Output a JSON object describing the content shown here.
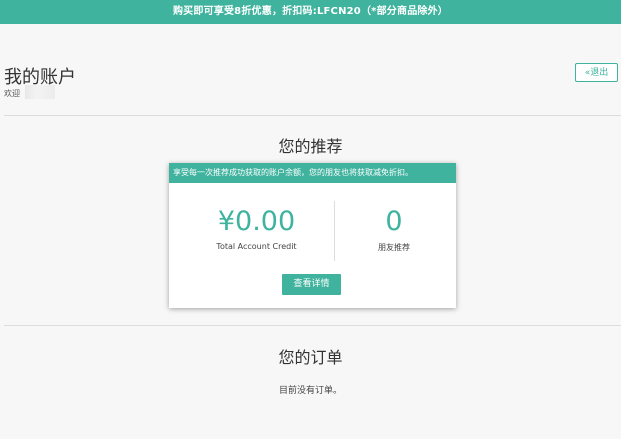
{
  "promo_banner": "购买即可享受8折优惠，折扣码:LFCN20（*部分商品除外）",
  "account": {
    "title": "我的账户",
    "welcome": "欢迎",
    "logout_label": "«退出"
  },
  "referral": {
    "section_title": "您的推荐",
    "card_header": "享受每一次推荐成功获取的账户余额，您的朋友也将获取减免折扣。",
    "credit_value": "¥0.00",
    "credit_label": "Total Account Credit",
    "referral_count": "0",
    "referral_label": "朋友推荐",
    "details_button": "查看详情"
  },
  "orders": {
    "section_title": "您的订单",
    "empty_message": "目前没有订单。"
  },
  "colors": {
    "accent": "#3fb39e"
  }
}
